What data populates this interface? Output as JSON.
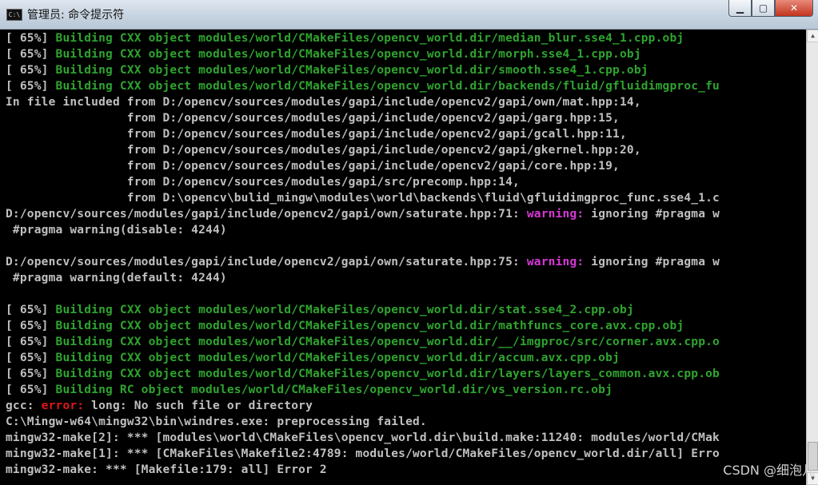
{
  "window": {
    "title": "管理员: 命令提示符",
    "icon_label": "C:\\",
    "minimize": "▁",
    "maximize": "▢",
    "close": "✕"
  },
  "colors": {
    "background": "#000000",
    "text": "#c0c0c0",
    "build": "#2fa52f",
    "warning": "#d838d8",
    "error": "#e01818"
  },
  "lines": [
    {
      "pre": "[ 65%] ",
      "build": "Building CXX object modules/world/CMakeFiles/opencv_world.dir/median_blur.sse4_1.cpp.obj"
    },
    {
      "pre": "[ 65%] ",
      "build": "Building CXX object modules/world/CMakeFiles/opencv_world.dir/morph.sse4_1.cpp.obj"
    },
    {
      "pre": "[ 65%] ",
      "build": "Building CXX object modules/world/CMakeFiles/opencv_world.dir/smooth.sse4_1.cpp.obj"
    },
    {
      "pre": "[ 65%] ",
      "build": "Building CXX object modules/world/CMakeFiles/opencv_world.dir/backends/fluid/gfluidimgproc_fu"
    },
    {
      "pre": "In file included from D:/opencv/sources/modules/gapi/include/opencv2/gapi/own/mat.hpp:14,"
    },
    {
      "pre": "                 from D:/opencv/sources/modules/gapi/include/opencv2/gapi/garg.hpp:15,"
    },
    {
      "pre": "                 from D:/opencv/sources/modules/gapi/include/opencv2/gapi/gcall.hpp:11,"
    },
    {
      "pre": "                 from D:/opencv/sources/modules/gapi/include/opencv2/gapi/gkernel.hpp:20,"
    },
    {
      "pre": "                 from D:/opencv/sources/modules/gapi/include/opencv2/gapi/core.hpp:19,"
    },
    {
      "pre": "                 from D:/opencv/sources/modules/gapi/src/precomp.hpp:14,"
    },
    {
      "pre": "                 from D:\\opencv\\bulid_mingw\\modules\\world\\backends\\fluid\\gfluidimgproc_func.sse4_1.c"
    },
    {
      "pre": "D:/opencv/sources/modules/gapi/include/opencv2/gapi/own/saturate.hpp:71: ",
      "warn": "warning:",
      "post": " ignoring #pragma w"
    },
    {
      "pre": " #pragma warning(disable: 4244)"
    },
    {
      "pre": ""
    },
    {
      "pre": "D:/opencv/sources/modules/gapi/include/opencv2/gapi/own/saturate.hpp:75: ",
      "warn": "warning:",
      "post": " ignoring #pragma w"
    },
    {
      "pre": " #pragma warning(default: 4244)"
    },
    {
      "pre": ""
    },
    {
      "pre": "[ 65%] ",
      "build": "Building CXX object modules/world/CMakeFiles/opencv_world.dir/stat.sse4_2.cpp.obj"
    },
    {
      "pre": "[ 65%] ",
      "build": "Building CXX object modules/world/CMakeFiles/opencv_world.dir/mathfuncs_core.avx.cpp.obj"
    },
    {
      "pre": "[ 65%] ",
      "build": "Building CXX object modules/world/CMakeFiles/opencv_world.dir/__/imgproc/src/corner.avx.cpp.o"
    },
    {
      "pre": "[ 65%] ",
      "build": "Building CXX object modules/world/CMakeFiles/opencv_world.dir/accum.avx.cpp.obj"
    },
    {
      "pre": "[ 65%] ",
      "build": "Building CXX object modules/world/CMakeFiles/opencv_world.dir/layers/layers_common.avx.cpp.ob"
    },
    {
      "pre": "[ 65%] ",
      "build": "Building RC object modules/world/CMakeFiles/opencv_world.dir/vs_version.rc.obj"
    },
    {
      "pre": "gcc: ",
      "err": "error:",
      "post": " long: No such file or directory"
    },
    {
      "pre": "C:\\Mingw-w64\\mingw32\\bin\\windres.exe: preprocessing failed."
    },
    {
      "pre": "mingw32-make[2]: *** [modules\\world\\CMakeFiles\\opencv_world.dir\\build.make:11240: modules/world/CMak"
    },
    {
      "pre": "mingw32-make[1]: *** [CMakeFiles\\Makefile2:4789: modules/world/CMakeFiles/opencv_world.dir/all] Erro"
    },
    {
      "pre": "mingw32-make: *** [Makefile:179: all] Error 2"
    }
  ],
  "scrollbar": {
    "up": "▲",
    "down": "▼"
  },
  "watermark": "CSDN @细泡儿"
}
